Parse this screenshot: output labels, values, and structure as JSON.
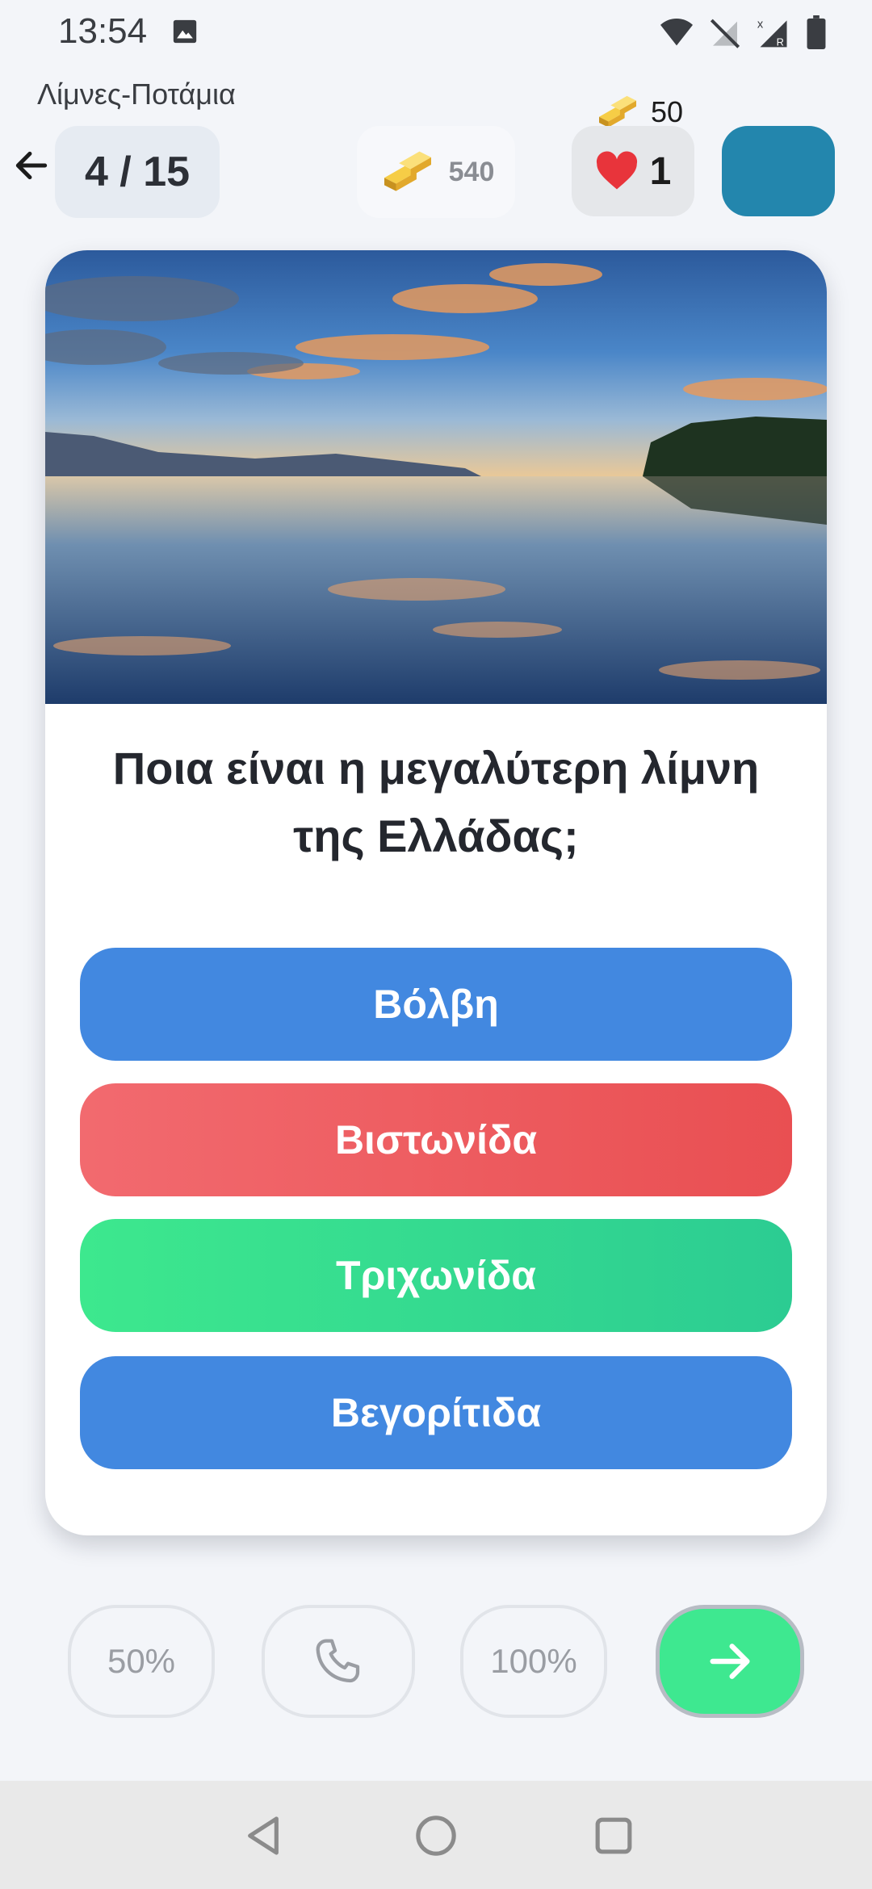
{
  "status_bar": {
    "time": "13:54",
    "icons": [
      "photo-icon",
      "wifi-icon",
      "no-signal-icon",
      "signal-roaming-icon",
      "battery-icon"
    ]
  },
  "header": {
    "category": "Λίμνες-Ποτάμια",
    "progress": "4 / 15",
    "coins": "540",
    "bonus_coins": "50",
    "lives": "1",
    "avatar_color": "#2386ad"
  },
  "question": {
    "text": "Ποια είναι η μεγαλύτερη λίμνη της Ελλάδας;",
    "answers": [
      {
        "label": "Βόλβη",
        "color": "#4288e0"
      },
      {
        "label": "Βιστωνίδα",
        "color": "#ec5a5e"
      },
      {
        "label": "Τριχωνίδα",
        "color": "#34d990"
      },
      {
        "label": "Βεγορίτιδα",
        "color": "#4288e0"
      }
    ]
  },
  "lifelines": {
    "fifty": "50%",
    "phone_icon": "phone-icon",
    "hundred": "100%",
    "next_icon": "arrow-right-icon",
    "next_color": "#3ee890"
  },
  "nav": {
    "items": [
      "back-triangle-icon",
      "home-circle-icon",
      "recents-square-icon"
    ]
  }
}
